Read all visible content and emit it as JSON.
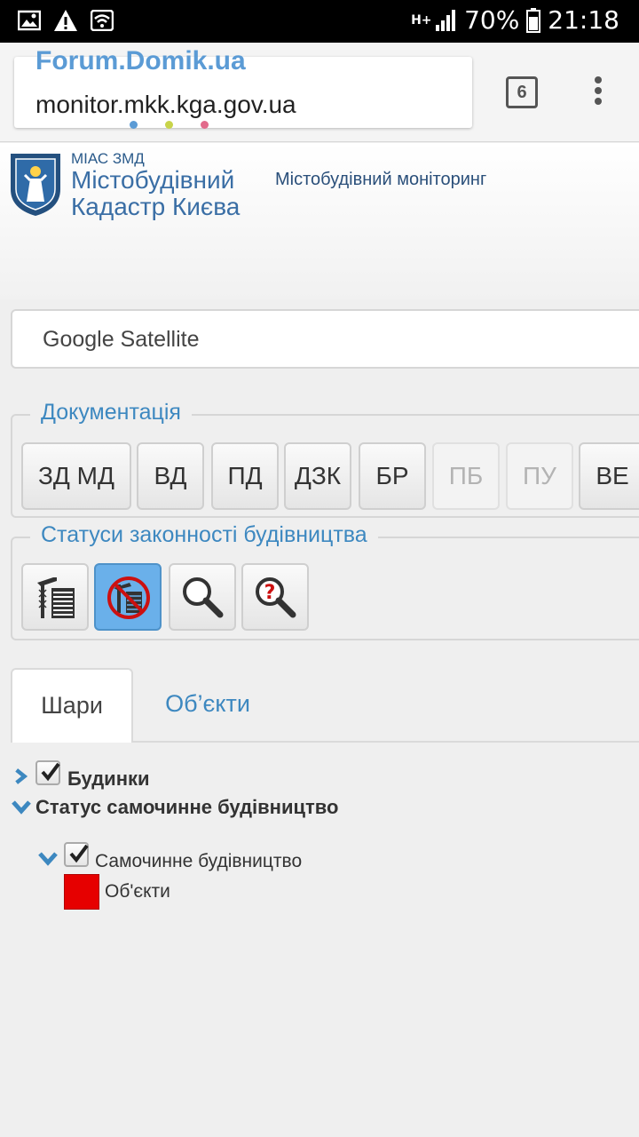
{
  "status_bar": {
    "network": "H+",
    "battery_percent": "70%",
    "time": "21:18"
  },
  "browser": {
    "watermark": "Forum.Domik.ua",
    "url": "monitor.mkk.kga.gov.ua",
    "tab_count": "6"
  },
  "site_header": {
    "logo_small": "МІАС ЗМД",
    "logo_line1": "Містобудівний",
    "logo_line2": "Кадастр Києва",
    "subtitle": "Містобудівний моніторинг"
  },
  "map_layer": {
    "selected": "Google Satellite"
  },
  "documentation": {
    "legend": "Документація",
    "buttons": [
      {
        "label": "ЗД МД",
        "enabled": true
      },
      {
        "label": "ВД",
        "enabled": true
      },
      {
        "label": "ПД",
        "enabled": true
      },
      {
        "label": "ДЗК",
        "enabled": true
      },
      {
        "label": "БР",
        "enabled": true
      },
      {
        "label": "ПБ",
        "enabled": false
      },
      {
        "label": "ПУ",
        "enabled": false
      },
      {
        "label": "ВЕ",
        "enabled": true
      }
    ]
  },
  "legality": {
    "legend": "Статуси законності будівництва",
    "icons": [
      "legal-construction-icon",
      "illegal-construction-icon",
      "search-icon",
      "unknown-search-icon"
    ],
    "active_index": 1
  },
  "tabs": {
    "layers": "Шари",
    "objects": "Об’єкти",
    "active": "layers"
  },
  "tree": {
    "buildings": {
      "label": "Будинки",
      "checked": true
    },
    "status_group": {
      "label": "Статус самочинне будівництво"
    },
    "illegal": {
      "label": "Самочинне будівництво",
      "checked": true
    },
    "legend_item": {
      "label": "Об'єкти",
      "color": "#e60000"
    }
  }
}
